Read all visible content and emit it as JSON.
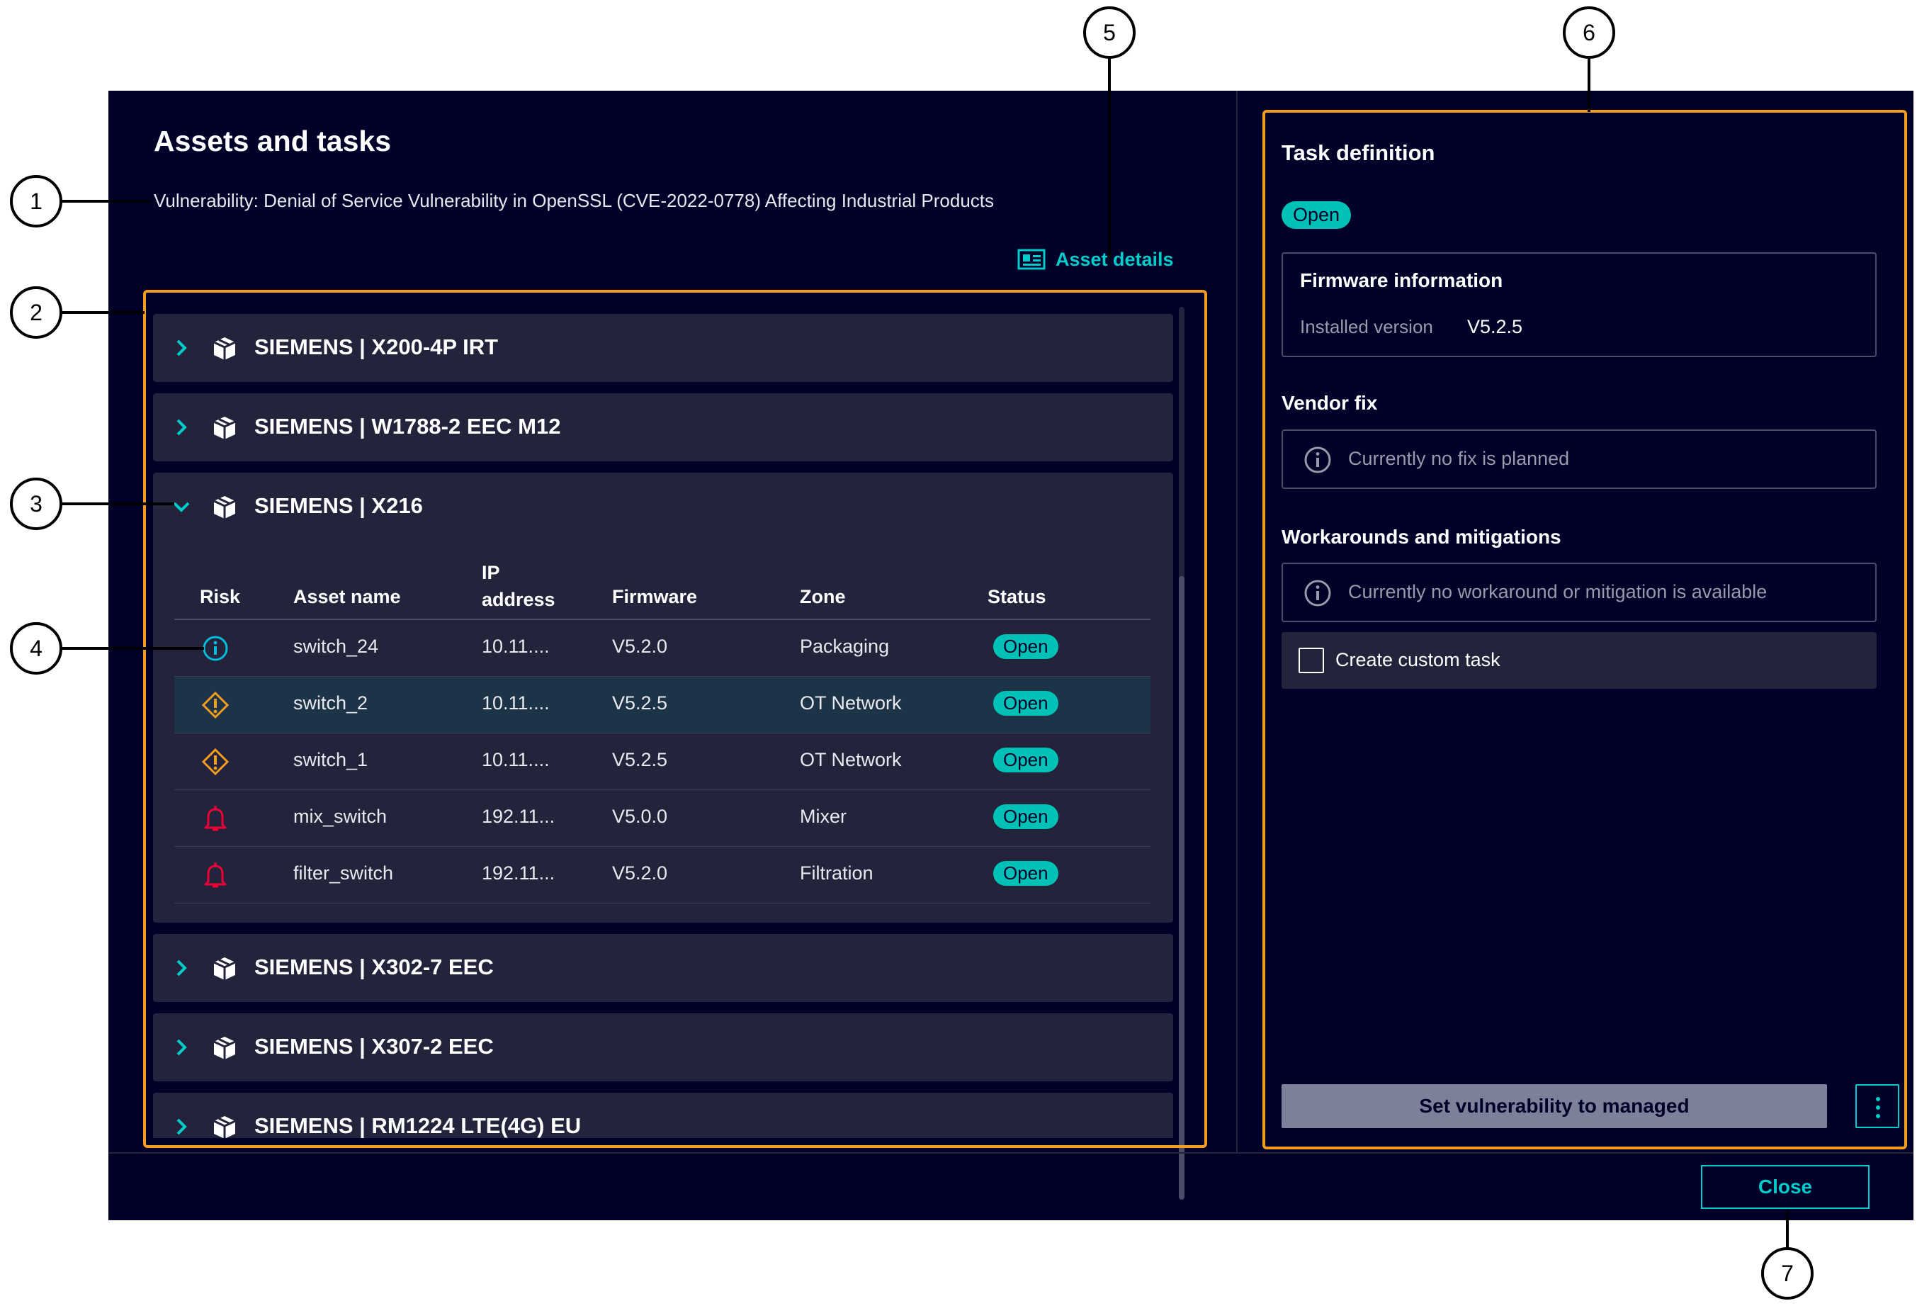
{
  "dialog": {
    "title": "Assets and tasks",
    "subtitle": "Vulnerability: Denial of Service Vulnerability in OpenSSL (CVE-2022-0778) Affecting Industrial Products",
    "asset_details_link": "Asset details",
    "close_button": "Close"
  },
  "assets": [
    {
      "label": "SIEMENS | X200-4P IRT",
      "expanded": false
    },
    {
      "label": "SIEMENS | W1788-2 EEC M12",
      "expanded": false
    },
    {
      "label": "SIEMENS | X216",
      "expanded": true
    },
    {
      "label": "SIEMENS | X302-7 EEC",
      "expanded": false
    },
    {
      "label": "SIEMENS | X307-2 EEC",
      "expanded": false
    },
    {
      "label": "SIEMENS | RM1224 LTE(4G) EU",
      "expanded": false
    }
  ],
  "table": {
    "headers": {
      "risk": "Risk",
      "asset_name": "Asset name",
      "ip_line1": "IP",
      "ip_line2": "address",
      "firmware": "Firmware",
      "zone": "Zone",
      "status": "Status"
    },
    "rows": [
      {
        "risk": "info-icon",
        "name": "switch_24",
        "ip": "10.11....",
        "firmware": "V5.2.0",
        "zone": "Packaging",
        "status": "Open",
        "selected": false
      },
      {
        "risk": "warning-diamond-icon",
        "name": "switch_2",
        "ip": "10.11....",
        "firmware": "V5.2.5",
        "zone": "OT Network",
        "status": "Open",
        "selected": true
      },
      {
        "risk": "warning-diamond-icon",
        "name": "switch_1",
        "ip": "10.11....",
        "firmware": "V5.2.5",
        "zone": "OT Network",
        "status": "Open",
        "selected": false
      },
      {
        "risk": "alarm-bell-icon",
        "name": "mix_switch",
        "ip": "192.11...",
        "firmware": "V5.0.0",
        "zone": "Mixer",
        "status": "Open",
        "selected": false
      },
      {
        "risk": "alarm-bell-icon",
        "name": "filter_switch",
        "ip": "192.11...",
        "firmware": "V5.2.0",
        "zone": "Filtration",
        "status": "Open",
        "selected": false
      }
    ]
  },
  "task": {
    "title": "Task definition",
    "status": "Open",
    "firmware_title": "Firmware information",
    "installed_label": "Installed version",
    "installed_value": "V5.2.5",
    "vendor_fix_label": "Vendor fix",
    "vendor_fix_text": "Currently no fix is planned",
    "workarounds_label": "Workarounds and mitigations",
    "workarounds_text": "Currently no workaround or mitigation is available",
    "custom_task_label": "Create custom task",
    "managed_button": "Set vulnerability to managed"
  },
  "callouts": [
    "1",
    "2",
    "3",
    "4",
    "5",
    "6",
    "7"
  ],
  "colors": {
    "background": "#000028",
    "accent": "#00cccc",
    "status_pill": "#00c1b6",
    "highlight": "#f39c1f",
    "info": "#00bedc",
    "warning": "#f39c1f",
    "alarm": "#ef0137"
  }
}
